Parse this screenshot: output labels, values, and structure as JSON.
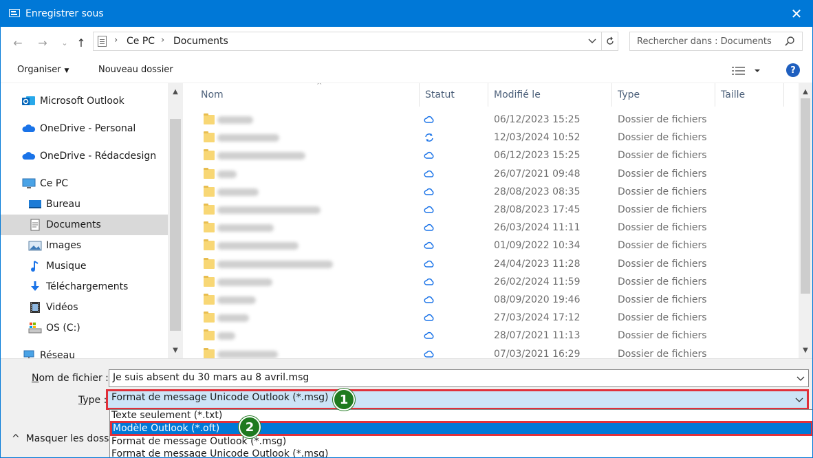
{
  "window": {
    "title": "Enregistrer sous",
    "close_glyph": "✕"
  },
  "nav": {
    "back_glyph": "←",
    "forward_glyph": "→",
    "recent_glyph": "⌄",
    "up_glyph": "↑",
    "breadcrumbs": [
      "Ce PC",
      "Documents"
    ],
    "breadcrumb_sep": "›",
    "search_placeholder": "Rechercher dans : Documents"
  },
  "toolbar": {
    "organize_label": "Organiser",
    "new_folder_label": "Nouveau dossier",
    "help_glyph": "?"
  },
  "sidebar": {
    "items": [
      {
        "label": "Microsoft Outlook",
        "icon": "outlook-icon",
        "indent": false,
        "selected": false
      },
      {
        "label": "OneDrive - Personal",
        "icon": "onedrive-icon",
        "indent": false,
        "selected": false
      },
      {
        "label": "OneDrive - Rédacdesign",
        "icon": "onedrive-icon",
        "indent": false,
        "selected": false
      },
      {
        "label": "Ce PC",
        "icon": "pc-icon",
        "indent": false,
        "selected": false
      },
      {
        "label": "Bureau",
        "icon": "desktop-icon",
        "indent": true,
        "selected": false
      },
      {
        "label": "Documents",
        "icon": "documents-icon",
        "indent": true,
        "selected": true
      },
      {
        "label": "Images",
        "icon": "images-icon",
        "indent": true,
        "selected": false
      },
      {
        "label": "Musique",
        "icon": "music-icon",
        "indent": true,
        "selected": false
      },
      {
        "label": "Téléchargements",
        "icon": "downloads-icon",
        "indent": true,
        "selected": false
      },
      {
        "label": "Vidéos",
        "icon": "videos-icon",
        "indent": true,
        "selected": false
      },
      {
        "label": "OS (C:)",
        "icon": "drive-icon",
        "indent": true,
        "selected": false
      },
      {
        "label": "Réseau",
        "icon": "network-icon",
        "indent": false,
        "selected": false
      }
    ]
  },
  "files": {
    "columns": [
      "Nom",
      "Statut",
      "Modifié le",
      "Type",
      "Taille"
    ],
    "rows": [
      {
        "status": "cloud",
        "modified": "06/12/2023 15:25",
        "type": "Dossier de fichiers"
      },
      {
        "status": "sync",
        "modified": "12/03/2024 10:52",
        "type": "Dossier de fichiers"
      },
      {
        "status": "cloud",
        "modified": "06/12/2023 15:25",
        "type": "Dossier de fichiers"
      },
      {
        "status": "cloud",
        "modified": "26/07/2021 09:48",
        "type": "Dossier de fichiers"
      },
      {
        "status": "cloud",
        "modified": "28/08/2023 08:35",
        "type": "Dossier de fichiers"
      },
      {
        "status": "cloud",
        "modified": "28/08/2023 17:45",
        "type": "Dossier de fichiers"
      },
      {
        "status": "cloud",
        "modified": "26/03/2024 11:11",
        "type": "Dossier de fichiers"
      },
      {
        "status": "cloud",
        "modified": "01/09/2022 10:34",
        "type": "Dossier de fichiers"
      },
      {
        "status": "cloud",
        "modified": "24/04/2023 11:28",
        "type": "Dossier de fichiers"
      },
      {
        "status": "cloud",
        "modified": "26/02/2024 11:59",
        "type": "Dossier de fichiers"
      },
      {
        "status": "cloud",
        "modified": "08/09/2020 19:46",
        "type": "Dossier de fichiers"
      },
      {
        "status": "cloud",
        "modified": "27/03/2024 17:12",
        "type": "Dossier de fichiers"
      },
      {
        "status": "cloud",
        "modified": "28/07/2021 11:13",
        "type": "Dossier de fichiers"
      },
      {
        "status": "cloud",
        "modified": "07/03/2021 16:29",
        "type": "Dossier de fichiers"
      }
    ]
  },
  "save": {
    "filename_label_u": "N",
    "filename_label_rest": "om de fichier :",
    "filename_value": "Je suis absent du 30 mars au 8 avril.msg",
    "type_label_u": "T",
    "type_label_rest": "ype :",
    "type_value": "Format de message Unicode Outlook (*.msg)",
    "type_options": [
      "Texte seulement (*.txt)",
      "Modèle Outlook (*.oft)",
      "Format de message Outlook (*.msg)",
      "Format de message Unicode Outlook (*.msg)"
    ],
    "selected_option_index": 1,
    "hide_folders_label": "Masquer les dossiers"
  },
  "annotations": {
    "badge_1": "1",
    "badge_2": "2"
  },
  "colors": {
    "accent": "#0078d7",
    "highlight_border": "#e0303a",
    "badge": "#1f7a1f"
  }
}
